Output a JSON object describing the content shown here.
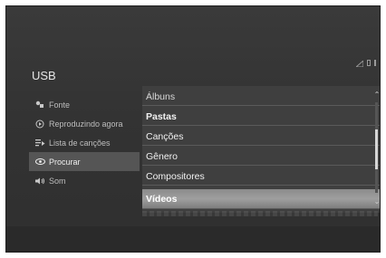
{
  "header": {
    "title": "USB"
  },
  "status_icons": [
    "signal-icon",
    "battery-icon",
    "indicator-icon"
  ],
  "sidebar": {
    "items": [
      {
        "label": "Fonte",
        "icon": "source-icon",
        "selected": false
      },
      {
        "label": "Reproduzindo agora",
        "icon": "play-circle-icon",
        "selected": false
      },
      {
        "label": "Lista de canções",
        "icon": "playlist-icon",
        "selected": false
      },
      {
        "label": "Procurar",
        "icon": "eye-icon",
        "selected": true
      },
      {
        "label": "Som",
        "icon": "speaker-icon",
        "selected": false
      }
    ]
  },
  "browse_list": {
    "items": [
      {
        "label": "Álbuns"
      },
      {
        "label": "Pastas"
      },
      {
        "label": "Canções"
      },
      {
        "label": "Gênero"
      },
      {
        "label": "Compositores"
      },
      {
        "label": "Vídeos",
        "highlighted": true
      }
    ]
  },
  "scrollbar": {
    "up_glyph": "⌃",
    "down_glyph": "⌄"
  }
}
